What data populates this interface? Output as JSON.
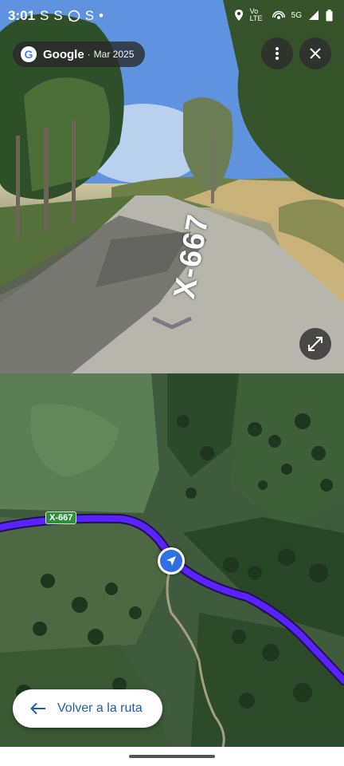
{
  "status_bar": {
    "time": "3:01",
    "left_icons": [
      "S",
      "S",
      "whatsapp-icon",
      "S",
      "•"
    ],
    "network_label": "Vo LTE",
    "signal_label": "5G"
  },
  "street_view": {
    "brand": "Google",
    "separator": "·",
    "date": "Mar 2025",
    "road_label": "X-667"
  },
  "map": {
    "road_shield": "X-667",
    "route_color": "#5a22ff"
  },
  "back_button": {
    "label": "Volver a la ruta"
  }
}
